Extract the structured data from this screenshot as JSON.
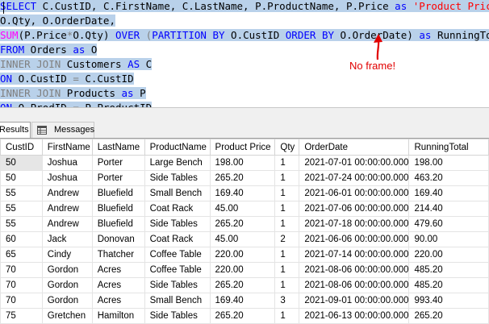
{
  "editor": {
    "lines": [
      [
        {
          "t": "SELECT",
          "c": "kw"
        },
        {
          "t": " C.CustID, C.FirstName, C.LastName, P.ProductName, P.Price ",
          "c": "tx"
        },
        {
          "t": "as",
          "c": "kw"
        },
        {
          "t": " ",
          "c": "tx"
        },
        {
          "t": "'Product Price'",
          "c": "str"
        },
        {
          "t": ",",
          "c": "gr"
        }
      ],
      [
        {
          "t": "O.Qty, O.OrderDate,",
          "c": "tx"
        }
      ],
      [
        {
          "t": "SUM",
          "c": "fn"
        },
        {
          "t": "(P.Price",
          "c": "tx"
        },
        {
          "t": "*",
          "c": "gr"
        },
        {
          "t": "O.Qty) ",
          "c": "tx"
        },
        {
          "t": "OVER",
          "c": "kw"
        },
        {
          "t": " (",
          "c": "gr"
        },
        {
          "t": "PARTITION",
          "c": "kw"
        },
        {
          "t": " ",
          "c": "tx"
        },
        {
          "t": "BY",
          "c": "kw"
        },
        {
          "t": " O.CustID ",
          "c": "tx"
        },
        {
          "t": "ORDER",
          "c": "kw"
        },
        {
          "t": " ",
          "c": "tx"
        },
        {
          "t": "BY",
          "c": "kw"
        },
        {
          "t": " O.OrderDate) ",
          "c": "tx"
        },
        {
          "t": "as",
          "c": "kw"
        },
        {
          "t": " RunningTotal",
          "c": "tx"
        }
      ],
      [
        {
          "t": "FROM",
          "c": "kw"
        },
        {
          "t": " Orders ",
          "c": "tx"
        },
        {
          "t": "as",
          "c": "kw"
        },
        {
          "t": " O",
          "c": "tx"
        }
      ],
      [
        {
          "t": "INNER JOIN",
          "c": "gr"
        },
        {
          "t": " Customers ",
          "c": "tx"
        },
        {
          "t": "AS",
          "c": "kw"
        },
        {
          "t": " C",
          "c": "tx"
        }
      ],
      [
        {
          "t": "ON",
          "c": "kw"
        },
        {
          "t": " O.CustID ",
          "c": "tx"
        },
        {
          "t": "=",
          "c": "gr"
        },
        {
          "t": " C.CustID",
          "c": "tx"
        }
      ],
      [
        {
          "t": "INNER JOIN",
          "c": "gr"
        },
        {
          "t": " Products ",
          "c": "tx"
        },
        {
          "t": "as",
          "c": "kw"
        },
        {
          "t": " P",
          "c": "tx"
        }
      ],
      [
        {
          "t": "ON",
          "c": "kw"
        },
        {
          "t": " O.ProdID ",
          "c": "tx"
        },
        {
          "t": "=",
          "c": "gr"
        },
        {
          "t": " P.ProductID",
          "c": "tx"
        }
      ]
    ],
    "annotation": "No frame!",
    "colors": {
      "keyword": "#0000ff",
      "function": "#ff00ff",
      "string": "#ff0000",
      "operator": "#808080",
      "selection": "#b9d1ea",
      "annotation": "#e10000"
    }
  },
  "tabs": {
    "results_label": "Results",
    "messages_label": "Messages",
    "messages_icon": "messages-grid-icon"
  },
  "grid": {
    "columns": [
      "CustID",
      "FirstName",
      "LastName",
      "ProductName",
      "Product Price",
      "Qty",
      "OrderDate",
      "RunningTotal"
    ],
    "rows": [
      [
        "50",
        "Joshua",
        "Porter",
        "Large Bench",
        "198.00",
        "1",
        "2021-07-01 00:00:00.000",
        "198.00"
      ],
      [
        "50",
        "Joshua",
        "Porter",
        "Side Tables",
        "265.20",
        "1",
        "2021-07-24 00:00:00.000",
        "463.20"
      ],
      [
        "55",
        "Andrew",
        "Bluefield",
        "Small Bench",
        "169.40",
        "1",
        "2021-06-01 00:00:00.000",
        "169.40"
      ],
      [
        "55",
        "Andrew",
        "Bluefield",
        "Coat Rack",
        "45.00",
        "1",
        "2021-07-06 00:00:00.000",
        "214.40"
      ],
      [
        "55",
        "Andrew",
        "Bluefield",
        "Side Tables",
        "265.20",
        "1",
        "2021-07-18 00:00:00.000",
        "479.60"
      ],
      [
        "60",
        "Jack",
        "Donovan",
        "Coat Rack",
        "45.00",
        "2",
        "2021-06-06 00:00:00.000",
        "90.00"
      ],
      [
        "65",
        "Cindy",
        "Thatcher",
        "Coffee Table",
        "220.00",
        "1",
        "2021-07-14 00:00:00.000",
        "220.00"
      ],
      [
        "70",
        "Gordon",
        "Acres",
        "Coffee Table",
        "220.00",
        "1",
        "2021-08-06 00:00:00.000",
        "485.20"
      ],
      [
        "70",
        "Gordon",
        "Acres",
        "Side Tables",
        "265.20",
        "1",
        "2021-08-06 00:00:00.000",
        "485.20"
      ],
      [
        "70",
        "Gordon",
        "Acres",
        "Small Bench",
        "169.40",
        "3",
        "2021-09-01 00:00:00.000",
        "993.40"
      ],
      [
        "75",
        "Gretchen",
        "Hamilton",
        "Side Tables",
        "265.20",
        "1",
        "2021-06-13 00:00:00.000",
        "265.20"
      ]
    ]
  }
}
